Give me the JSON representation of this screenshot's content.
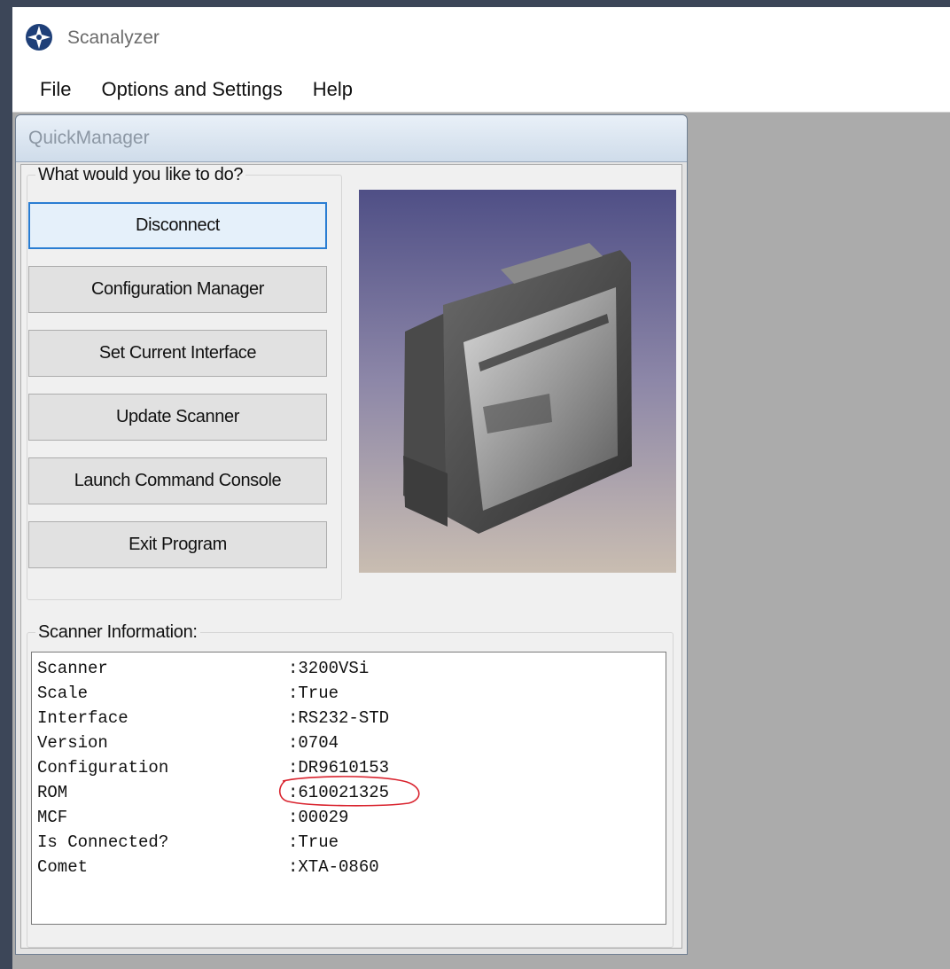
{
  "app": {
    "title": "Scanalyzer"
  },
  "menu": [
    "File",
    "Options and Settings",
    "Help"
  ],
  "quick_manager": {
    "title": "QuickManager",
    "actions_legend": "What would you like to do?",
    "buttons": [
      {
        "label": "Disconnect",
        "focused": true
      },
      {
        "label": "Configuration Manager"
      },
      {
        "label": "Set Current Interface"
      },
      {
        "label": "Update Scanner"
      },
      {
        "label": "Launch Command Console"
      },
      {
        "label": "Exit Program"
      }
    ],
    "info_legend": "Scanner Information:",
    "info": [
      {
        "key": "Scanner",
        "value": ":3200VSi"
      },
      {
        "key": "Scale",
        "value": ":True"
      },
      {
        "key": "Interface",
        "value": ":RS232-STD"
      },
      {
        "key": "Version",
        "value": ":0704"
      },
      {
        "key": "Configuration",
        "value": ":DR9610153"
      },
      {
        "key": "ROM",
        "value": ":610021325",
        "highlighted": true
      },
      {
        "key": "MCF",
        "value": ":00029"
      },
      {
        "key": "Is Connected?",
        "value": ":True"
      },
      {
        "key": "Comet",
        "value": ":XTA-0860"
      }
    ]
  },
  "colors": {
    "focus_border": "#2a7dd2",
    "annotation": "#d9232e",
    "workspace": "#ababab"
  }
}
